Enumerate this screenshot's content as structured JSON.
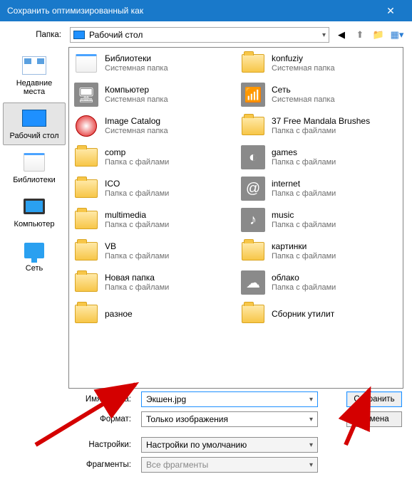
{
  "title": "Сохранить оптимизированный как",
  "folder_label": "Папка:",
  "folder_value": "Рабочий стол",
  "places": [
    {
      "label": "Недавние места",
      "icon": "recent"
    },
    {
      "label": "Рабочий стол",
      "icon": "desktop",
      "selected": true
    },
    {
      "label": "Библиотеки",
      "icon": "libraries"
    },
    {
      "label": "Компьютер",
      "icon": "computer"
    },
    {
      "label": "Сеть",
      "icon": "network"
    }
  ],
  "left_items": [
    {
      "name": "Библиотеки",
      "sub": "Системная папка",
      "icon": "lib"
    },
    {
      "name": "Компьютер",
      "sub": "Системная папка",
      "icon": "tile",
      "glyph": "🖥"
    },
    {
      "name": "Image Catalog",
      "sub": "Системная папка",
      "icon": "round"
    },
    {
      "name": "comp",
      "sub": "Папка с файлами",
      "icon": "folder"
    },
    {
      "name": "ICO",
      "sub": "Папка с файлами",
      "icon": "folder"
    },
    {
      "name": "multimedia",
      "sub": "Папка с файлами",
      "icon": "folder"
    },
    {
      "name": "VB",
      "sub": "Папка с файлами",
      "icon": "folder"
    },
    {
      "name": "Новая папка",
      "sub": "Папка с файлами",
      "icon": "folder"
    },
    {
      "name": "разное",
      "sub": "",
      "icon": "folder"
    }
  ],
  "right_items": [
    {
      "name": "konfuziy",
      "sub": "Системная папка",
      "icon": "folder"
    },
    {
      "name": "Сеть",
      "sub": "Системная папка",
      "icon": "tile",
      "glyph": "📶"
    },
    {
      "name": "37 Free Mandala Brushes",
      "sub": "Папка с файлами",
      "icon": "folder"
    },
    {
      "name": "games",
      "sub": "Папка с файлами",
      "icon": "tile",
      "glyph": "◐"
    },
    {
      "name": "internet",
      "sub": "Папка с файлами",
      "icon": "tile",
      "glyph": "@"
    },
    {
      "name": "music",
      "sub": "Папка с файлами",
      "icon": "tile",
      "glyph": "♪"
    },
    {
      "name": "картинки",
      "sub": "Папка с файлами",
      "icon": "folder"
    },
    {
      "name": "облако",
      "sub": "Папка с файлами",
      "icon": "tile",
      "glyph": "☁"
    },
    {
      "name": "Сборник утилит",
      "sub": "",
      "icon": "folder"
    }
  ],
  "filename_label": "Имя файла:",
  "filename_value": "Экшен.jpg",
  "format_label": "Формат:",
  "format_value": "Только изображения",
  "settings_label": "Настройки:",
  "settings_value": "Настройки по умолчанию",
  "fragments_label": "Фрагменты:",
  "fragments_value": "Все фрагменты",
  "save_btn": "Сохранить",
  "cancel_btn": "Отмена"
}
